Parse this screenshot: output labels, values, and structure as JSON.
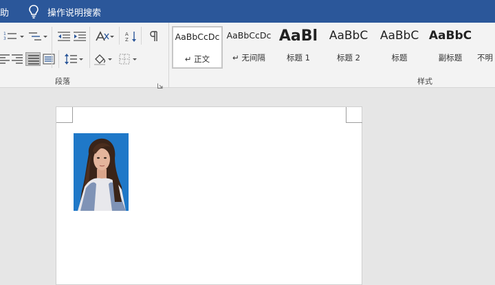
{
  "titlebar": {
    "help_label": "助",
    "tell_me": "操作说明搜索"
  },
  "colors": {
    "titlebar_bg": "#2b579a",
    "ribbon_bg": "#f3f3f3",
    "canvas_bg": "#e6e6e6",
    "photo_bg": "#1f78c8"
  },
  "ribbon": {
    "paragraph_group_label": "段落",
    "styles_group_label": "样式",
    "styles": [
      {
        "sample": "AaBbCcDc",
        "name": "↵ 正文",
        "selected": true
      },
      {
        "sample": "AaBbCcDc",
        "name": "↵ 无间隔",
        "selected": false
      },
      {
        "sample": "AaBl",
        "name": "标题 1",
        "selected": false
      },
      {
        "sample": "AaBbC",
        "name": "标题 2",
        "selected": false
      },
      {
        "sample": "AaBbC",
        "name": "标题",
        "selected": false
      },
      {
        "sample": "AaBbC",
        "name": "副标题",
        "selected": false
      },
      {
        "sample": "",
        "name": "不明",
        "selected": false
      }
    ],
    "icons": [
      "numbering-icon",
      "multilevel-list-icon",
      "decrease-indent-icon",
      "increase-indent-icon",
      "chinese-layout-icon",
      "sort-icon",
      "show-formatting-icon",
      "align-left-icon",
      "align-right-icon",
      "justify-icon",
      "distributed-icon",
      "line-spacing-icon",
      "shading-icon",
      "borders-icon"
    ]
  },
  "document": {
    "image_subject": "portrait-photo"
  }
}
